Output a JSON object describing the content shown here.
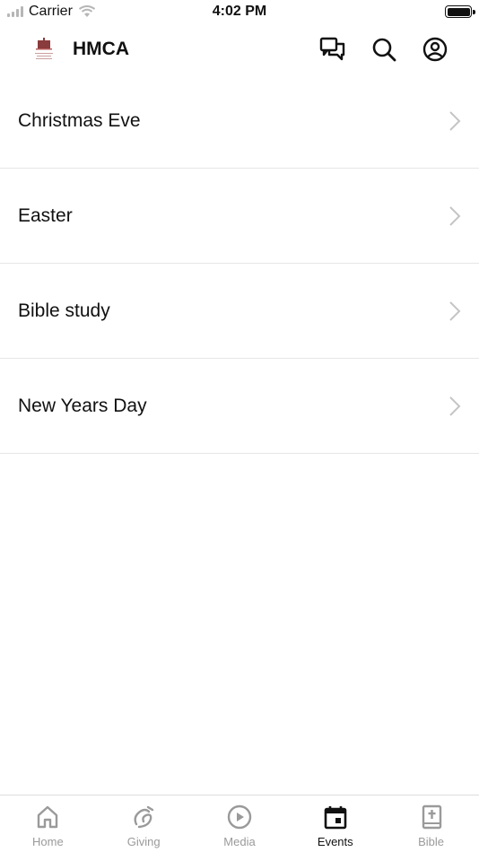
{
  "status_bar": {
    "carrier": "Carrier",
    "time": "4:02 PM"
  },
  "header": {
    "title": "HMCA"
  },
  "events": [
    {
      "label": "Christmas Eve"
    },
    {
      "label": "Easter"
    },
    {
      "label": "Bible study"
    },
    {
      "label": "New Years Day"
    }
  ],
  "tabs": [
    {
      "label": "Home",
      "icon": "home-icon",
      "active": false
    },
    {
      "label": "Giving",
      "icon": "giving-icon",
      "active": false
    },
    {
      "label": "Media",
      "icon": "play-icon",
      "active": false
    },
    {
      "label": "Events",
      "icon": "calendar-icon",
      "active": true
    },
    {
      "label": "Bible",
      "icon": "bible-icon",
      "active": false
    }
  ],
  "colors": {
    "active": "#111111",
    "inactive": "#9a9a9a",
    "divider": "#e6e6e6",
    "chevron": "#c4c4c4"
  }
}
